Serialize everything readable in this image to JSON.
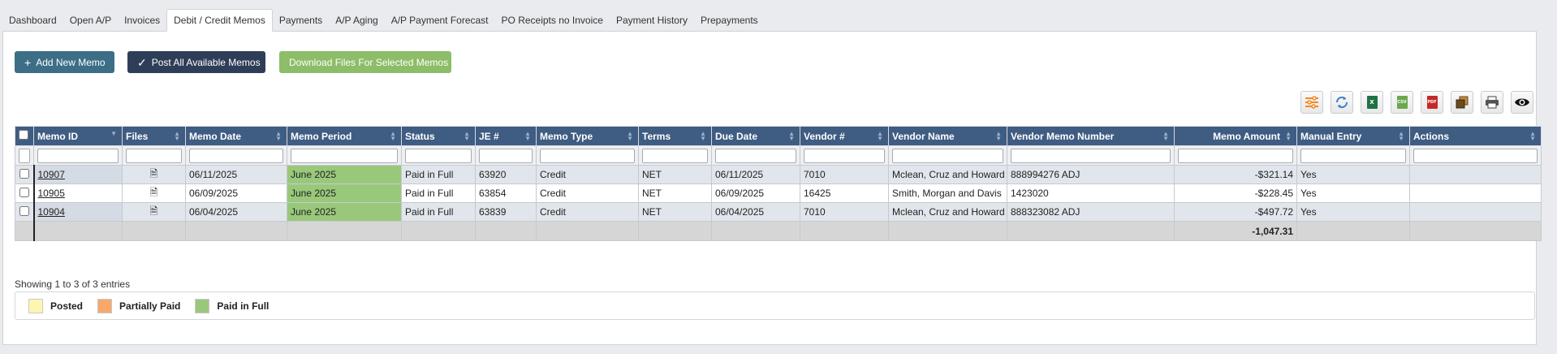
{
  "tabs": [
    "Dashboard",
    "Open A/P",
    "Invoices",
    "Debit / Credit Memos",
    "Payments",
    "A/P Aging",
    "A/P Payment Forecast",
    "PO Receipts no Invoice",
    "Payment History",
    "Prepayments"
  ],
  "actions": {
    "add_label": "Add New Memo",
    "post_label": "Post All Available Memos",
    "download_label": "Download Files For Selected Memos"
  },
  "toolbar": {
    "icons": [
      "column-settings-icon",
      "refresh-icon",
      "excel-export-icon",
      "csv-export-icon",
      "pdf-export-icon",
      "copy-icon",
      "print-icon",
      "view-icon"
    ],
    "excel_text": "X",
    "csv_text": "CSV",
    "pdf_text": "PDF"
  },
  "table": {
    "columns": [
      "Memo ID",
      "Files",
      "Memo Date",
      "Memo Period",
      "Status",
      "JE #",
      "Memo Type",
      "Terms",
      "Due Date",
      "Vendor #",
      "Vendor Name",
      "Vendor Memo Number",
      "Memo Amount",
      "Manual Entry",
      "Actions"
    ],
    "rows": [
      {
        "memo_id": "10907",
        "memo_date": "06/11/2025",
        "memo_period": "June 2025",
        "status": "Paid in Full",
        "je": "63920",
        "memo_type": "Credit",
        "terms": "NET",
        "due_date": "06/11/2025",
        "vendor_no": "7010",
        "vendor_name": "Mclean, Cruz and Howard",
        "vendor_memo_no": "888994276 ADJ",
        "amount": "-$321.14",
        "manual": "Yes"
      },
      {
        "memo_id": "10905",
        "memo_date": "06/09/2025",
        "memo_period": "June 2025",
        "status": "Paid in Full",
        "je": "63854",
        "memo_type": "Credit",
        "terms": "NET",
        "due_date": "06/09/2025",
        "vendor_no": "16425",
        "vendor_name": "Smith, Morgan and Davis",
        "vendor_memo_no": "1423020",
        "amount": "-$228.45",
        "manual": "Yes"
      },
      {
        "memo_id": "10904",
        "memo_date": "06/04/2025",
        "memo_period": "June 2025",
        "status": "Paid in Full",
        "je": "63839",
        "memo_type": "Credit",
        "terms": "NET",
        "due_date": "06/04/2025",
        "vendor_no": "7010",
        "vendor_name": "Mclean, Cruz and Howard",
        "vendor_memo_no": "888323082 ADJ",
        "amount": "-$497.72",
        "manual": "Yes"
      }
    ],
    "total_amount": "-1,047.31"
  },
  "footer": {
    "showing": "Showing 1 to 3 of 3 entries"
  },
  "legend": [
    {
      "label": "Posted",
      "color": "#fdf6b3"
    },
    {
      "label": "Partially Paid",
      "color": "#f8a86b"
    },
    {
      "label": "Paid in Full",
      "color": "#99c87b"
    }
  ],
  "colors": {
    "header_bg": "#3f5c82",
    "add_button": "#3d6e87",
    "post_button": "#2f3e58",
    "download_button": "#8dbd68",
    "paid_in_full": "#99c87b"
  }
}
